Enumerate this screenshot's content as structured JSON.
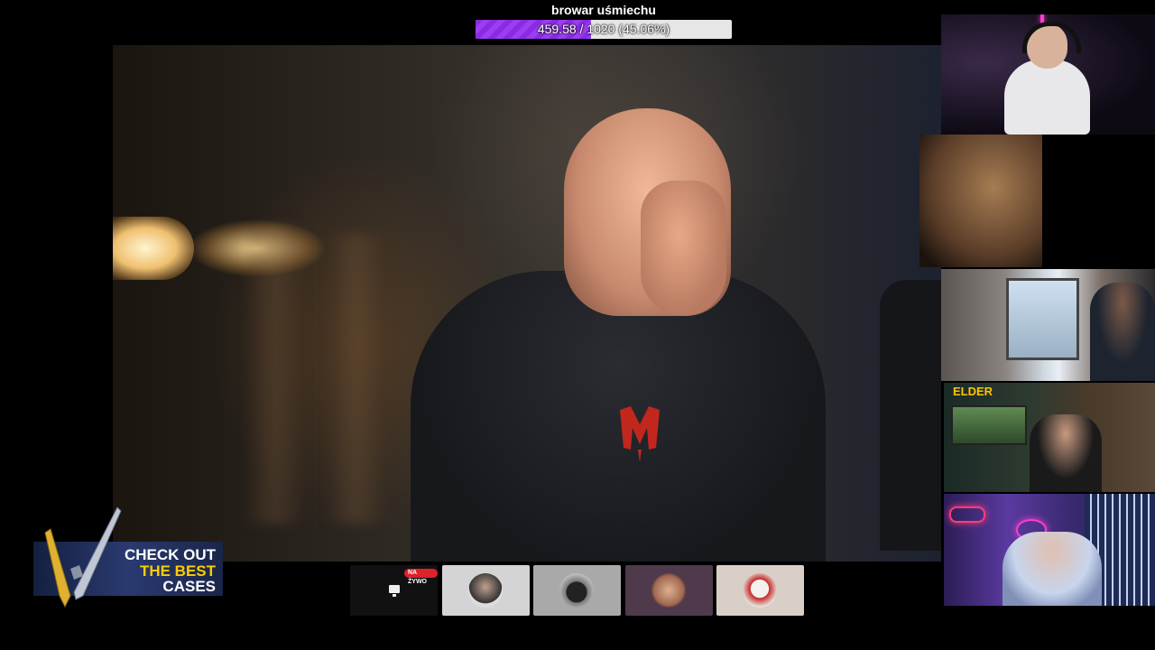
{
  "goal": {
    "title": "browar uśmiechu",
    "progress_text": "459.58 / 1020 (45.06%)",
    "current": 459.58,
    "target": 1020,
    "progress_fraction": 0.4506,
    "fill_color": "#8a2be2"
  },
  "ad": {
    "line1": "CHECK OUT",
    "line2": "THE BEST",
    "line3": "CASES",
    "accent_color": "#ffcc00"
  },
  "cams": {
    "cam4_logo": "ELDER"
  },
  "tiles": {
    "live_badge": "NA ŻYWO",
    "live_icon": "monitor-icon",
    "badge_color": "#e0202a"
  },
  "main_video": {
    "hoodie_logo_color": "#c1271d"
  }
}
